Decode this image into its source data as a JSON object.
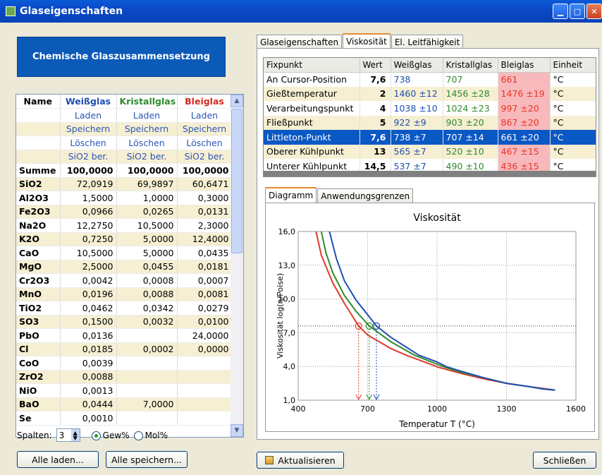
{
  "window": {
    "title": "Glaseigenschaften"
  },
  "left": {
    "header": "Chemische Glaszusammensetzung",
    "columns": [
      "Name",
      "Weißglas",
      "Kristallglas",
      "Bleiglas"
    ],
    "actions": [
      [
        "Laden",
        "Laden",
        "Laden"
      ],
      [
        "Speichern",
        "Speichern",
        "Speichern"
      ],
      [
        "Löschen",
        "Löschen",
        "Löschen"
      ],
      [
        "SiO2 ber.",
        "SiO2 ber.",
        "SiO2 ber."
      ]
    ],
    "rows": [
      [
        "Summe",
        "100,0000",
        "100,0000",
        "100,0000"
      ],
      [
        "SiO2",
        "72,0919",
        "69,9897",
        "60,6471"
      ],
      [
        "Al2O3",
        "1,5000",
        "1,0000",
        "0,3000"
      ],
      [
        "Fe2O3",
        "0,0966",
        "0,0265",
        "0,0131"
      ],
      [
        "Na2O",
        "12,2750",
        "10,5000",
        "2,3000"
      ],
      [
        "K2O",
        "0,7250",
        "5,0000",
        "12,4000"
      ],
      [
        "CaO",
        "10,5000",
        "5,0000",
        "0,0435"
      ],
      [
        "MgO",
        "2,5000",
        "0,0455",
        "0,0181"
      ],
      [
        "Cr2O3",
        "0,0042",
        "0,0008",
        "0,0007"
      ],
      [
        "MnO",
        "0,0196",
        "0,0088",
        "0,0081"
      ],
      [
        "TiO2",
        "0,0462",
        "0,0342",
        "0,0279"
      ],
      [
        "SO3",
        "0,1500",
        "0,0032",
        "0,0100"
      ],
      [
        "PbO",
        "0,0136",
        "",
        "24,0000"
      ],
      [
        "Cl",
        "0,0185",
        "0,0002",
        "0,0000"
      ],
      [
        "CoO",
        "0,0039",
        "",
        ""
      ],
      [
        "ZrO2",
        "0,0088",
        "",
        ""
      ],
      [
        "NiO",
        "0,0013",
        "",
        ""
      ],
      [
        "BaO",
        "0,0444",
        "7,0000",
        ""
      ],
      [
        "Se",
        "0,0010",
        "",
        ""
      ]
    ],
    "spalten_label": "Spalten:",
    "spalten_value": "3",
    "unit_options": [
      "Gew%",
      "Mol%"
    ],
    "unit_selected": "Gew%",
    "load_all": "Alle laden...",
    "save_all": "Alle speichern..."
  },
  "right": {
    "tabs": [
      "Glaseigenschaften",
      "Viskosität",
      "El. Leitfähigkeit"
    ],
    "active_tab": "Viskosität",
    "table": {
      "headers": [
        "Fixpunkt",
        "Wert",
        "Weißglas",
        "Kristallglas",
        "Bleiglas",
        "Einheit"
      ],
      "rows": [
        [
          "An Cursor-Position",
          "7,6",
          "738",
          "707",
          "661",
          "°C"
        ],
        [
          "Gießtemperatur",
          "2",
          "1460 ±12",
          "1456 ±28",
          "1476 ±19",
          "°C"
        ],
        [
          "Verarbeitungspunkt",
          "4",
          "1038 ±10",
          "1024 ±23",
          "997 ±20",
          "°C"
        ],
        [
          "Fließpunkt",
          "5",
          "922 ±9",
          "903 ±20",
          "867 ±20",
          "°C"
        ],
        [
          "Littleton-Punkt",
          "7,6",
          "738 ±7",
          "707 ±14",
          "661 ±20",
          "°C"
        ],
        [
          "Oberer Kühlpunkt",
          "13",
          "565 ±7",
          "520 ±10",
          "467 ±15",
          "°C"
        ],
        [
          "Unterer Kühlpunkt",
          "14,5",
          "537 ±7",
          "490 ±10",
          "436 ±15",
          "°C"
        ]
      ],
      "selected_row": 4
    },
    "subtabs": [
      "Diagramm",
      "Anwendungsgrenzen"
    ],
    "refresh": "Aktualisieren",
    "close": "Schließen"
  },
  "colors": {
    "weiss": "#1f4fb0",
    "kristall": "#2e8b2e",
    "blei": "#e03a2a"
  },
  "chart_data": {
    "type": "line",
    "title": "Viskosität",
    "xlabel": "Temperatur T (°C)",
    "ylabel": "Viskosität log(η/Poise)",
    "xlim": [
      400,
      1600
    ],
    "ylim": [
      1,
      16
    ],
    "xticks": [
      400,
      700,
      1000,
      1300,
      1600
    ],
    "yticks": [
      1.0,
      4.0,
      7.0,
      10.0,
      13.0,
      16.0
    ],
    "ytick_labels": [
      "1,0",
      "4,0",
      "7,0",
      "10,0",
      "13,0",
      "16,0"
    ],
    "grid": true,
    "cursor_log": 7.6,
    "series": [
      {
        "color": "#e03a2a",
        "x": [
          477,
          500,
          550,
          600,
          661,
          700,
          800,
          867,
          900,
          997,
          1000,
          1100,
          1200,
          1300,
          1400,
          1476,
          1510
        ],
        "y": [
          16,
          13.9,
          11.4,
          9.6,
          7.6,
          6.8,
          5.6,
          5,
          4.75,
          4,
          3.96,
          3.4,
          2.9,
          2.5,
          2.2,
          2,
          1.9
        ]
      },
      {
        "color": "#2e8b2e",
        "x": [
          500,
          520,
          550,
          600,
          650,
          707,
          800,
          903,
          1000,
          1024,
          1100,
          1200,
          1300,
          1400,
          1456,
          1510
        ],
        "y": [
          16,
          14.1,
          12.3,
          10.3,
          8.9,
          7.6,
          6.2,
          5,
          4.2,
          4,
          3.5,
          3,
          2.5,
          2.2,
          2,
          1.9
        ]
      },
      {
        "color": "#1f4fb0",
        "x": [
          535,
          565,
          600,
          650,
          700,
          738,
          800,
          922,
          1000,
          1038,
          1100,
          1200,
          1300,
          1400,
          1460,
          1510
        ],
        "y": [
          16,
          13.6,
          11.6,
          9.9,
          8.6,
          7.6,
          6.6,
          5,
          4.4,
          4,
          3.6,
          3,
          2.5,
          2.2,
          2,
          1.9
        ]
      }
    ],
    "markers": [
      661,
      707,
      738
    ]
  }
}
